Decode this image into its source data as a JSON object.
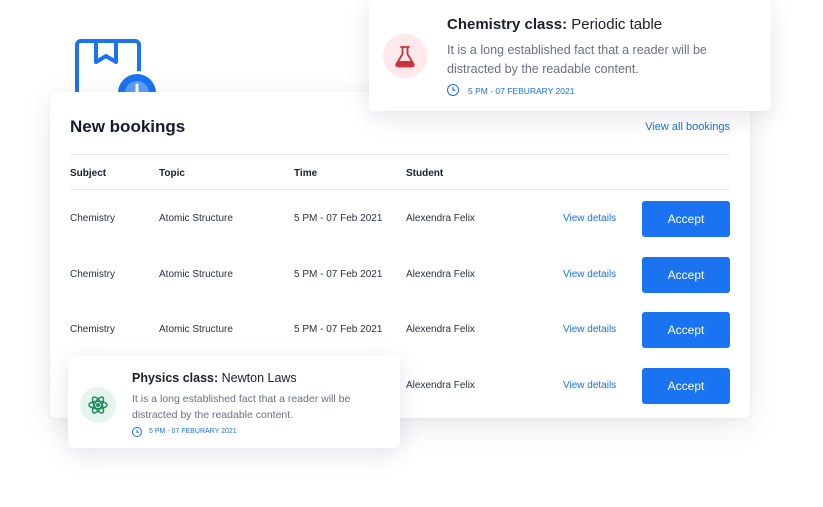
{
  "card": {
    "title": "New bookings",
    "view_all": "View all bookings",
    "columns": [
      "Subject",
      "Topic",
      "Time",
      "Student"
    ],
    "rows": [
      {
        "subject": "Chemistry",
        "topic": "Atomic Structure",
        "time": "5 PM - 07 Feb 2021",
        "student": "Alexendra Felix",
        "link": "View details",
        "action": "Accept"
      },
      {
        "subject": "Chemistry",
        "topic": "Atomic Structure",
        "time": "5 PM - 07 Feb 2021",
        "student": "Alexendra Felix",
        "link": "View details",
        "action": "Accept"
      },
      {
        "subject": "Chemistry",
        "topic": "Atomic Structure",
        "time": "5 PM - 07 Feb 2021",
        "student": "Alexendra Felix",
        "link": "View details",
        "action": "Accept"
      },
      {
        "subject": "",
        "topic": "",
        "time": "",
        "student": "Alexendra Felix",
        "link": "View details",
        "action": "Accept"
      }
    ]
  },
  "notifications": {
    "chemistry": {
      "title_bold": "Chemistry class:",
      "title_rest": " Periodic table",
      "body": "It is a long established fact that a reader will be distracted by the readable content.",
      "time": "5 PM - 07 FEBURARY 2021",
      "icon": "flask-icon"
    },
    "physics": {
      "title_bold": "Physics class:",
      "title_rest": " Newton Laws",
      "body": "It is a long established fact that a reader will be distracted by the readable content.",
      "time": "5 PM - 07 FEBURARY 2021",
      "icon": "atom-icon"
    }
  },
  "colors": {
    "accent": "#1a73f0",
    "chem_icon_bg": "#fde8ea",
    "chem_icon": "#c8323f",
    "phys_icon_bg": "#e6f4ee",
    "phys_icon": "#1f8a5b"
  }
}
